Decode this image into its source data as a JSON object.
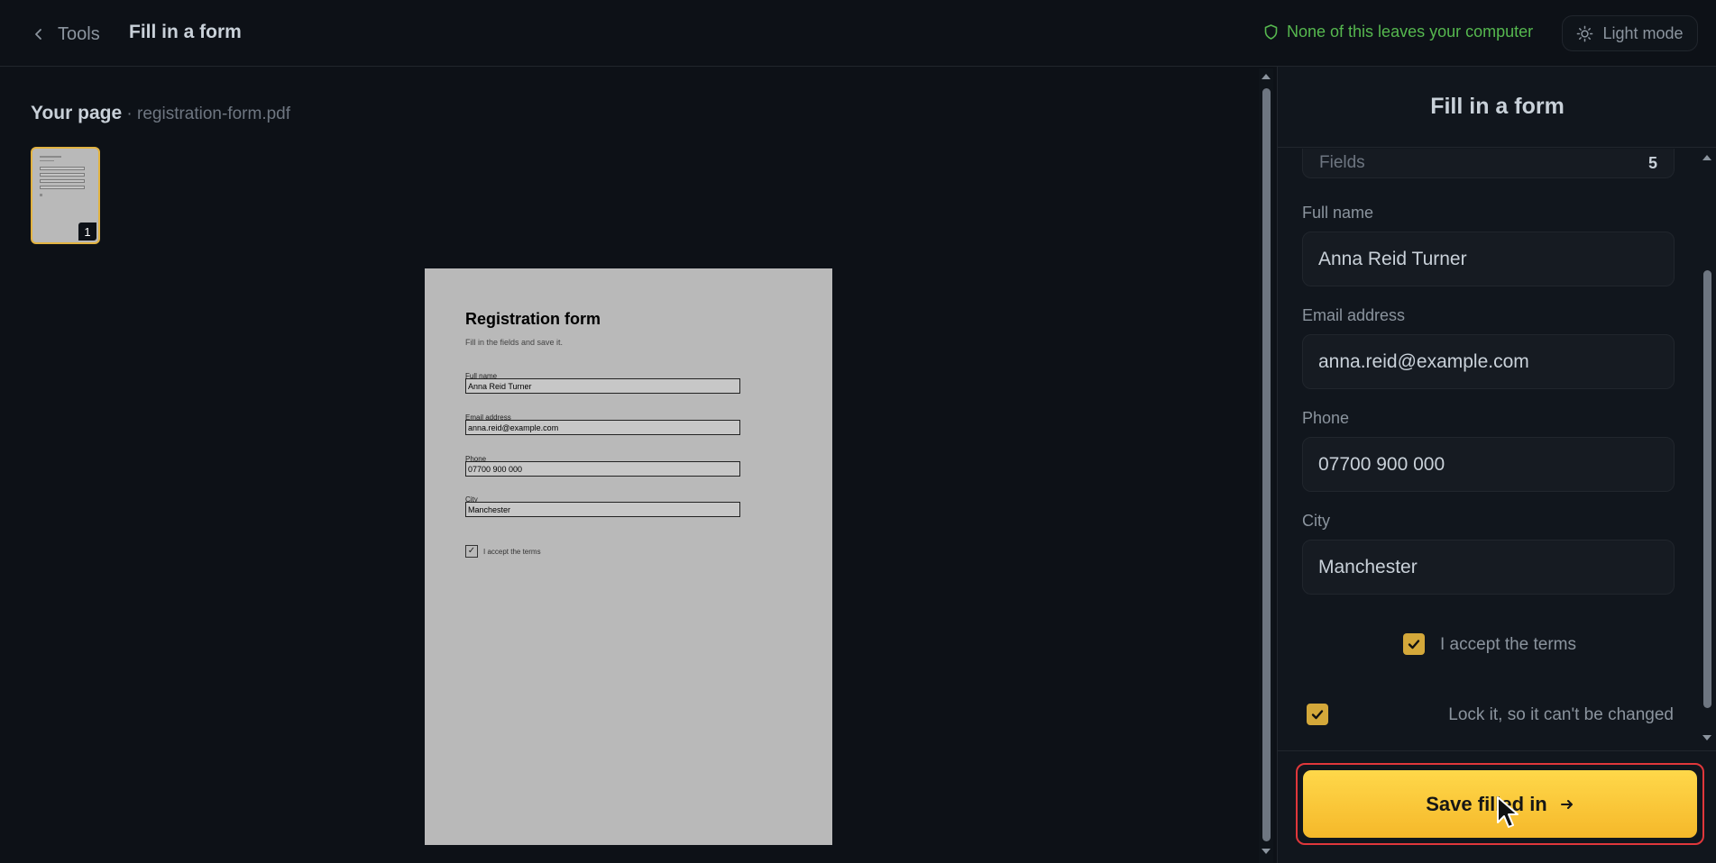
{
  "header": {
    "back_label": "Tools",
    "title": "Fill in a form",
    "privacy_note": "None of this leaves your computer",
    "mode_toggle_label": "Light mode"
  },
  "left": {
    "heading_strong": "Your page",
    "heading_file": " · registration-form.pdf",
    "thumbnail_page_number": "1"
  },
  "document": {
    "title": "Registration form",
    "subtitle": "Fill in the fields and save it.",
    "fields": [
      {
        "label": "Full name",
        "value": "Anna Reid Turner"
      },
      {
        "label": "Email address",
        "value": "anna.reid@example.com"
      },
      {
        "label": "Phone",
        "value": "07700 900 000"
      },
      {
        "label": "City",
        "value": "Manchester"
      }
    ],
    "checkbox_mark": "✓",
    "checkbox_label": "I accept the terms"
  },
  "panel": {
    "title": "Fill in a form",
    "fields_label": "Fields",
    "fields_count": "5",
    "form": [
      {
        "label": "Full name",
        "value": "Anna Reid Turner"
      },
      {
        "label": "Email address",
        "value": "anna.reid@example.com"
      },
      {
        "label": "Phone",
        "value": "07700 900 000"
      },
      {
        "label": "City",
        "value": "Manchester"
      }
    ],
    "accept_terms_label": "I accept the terms",
    "accept_terms_checked": true,
    "lock_label": "Lock it, so it can't be changed",
    "lock_checked": true,
    "save_button_label": "Save filled in"
  },
  "colors": {
    "accent": "#f5b82a",
    "privacy_green": "#56b84f",
    "highlight_border": "#e0373b",
    "background": "#0d1117"
  },
  "icons": [
    "chevron-left-icon",
    "shield-icon",
    "sun-icon",
    "checkmark-icon",
    "arrow-right-icon",
    "mouse-cursor-icon"
  ]
}
